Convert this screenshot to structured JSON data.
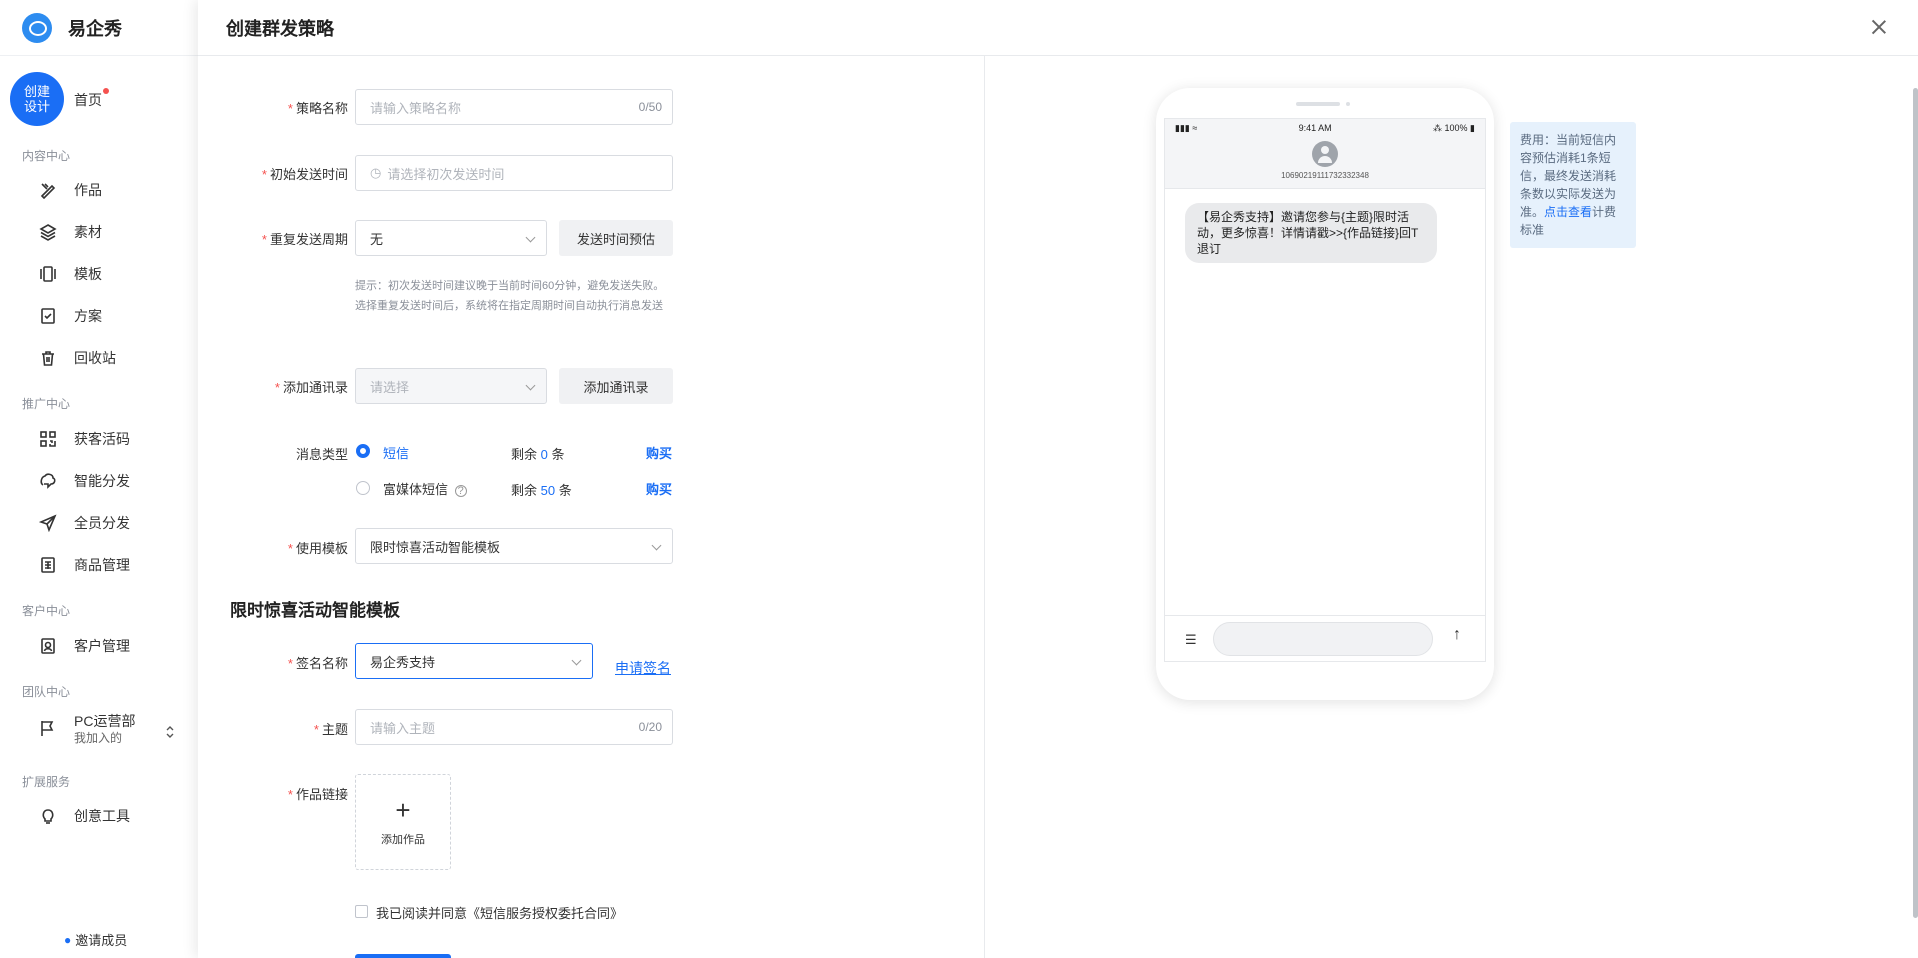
{
  "brand": {
    "name": "易企秀"
  },
  "sidebar": {
    "create_button": "创建设计",
    "home": "首页",
    "sections": [
      {
        "title": "内容中心",
        "items": [
          "作品",
          "素材",
          "模板",
          "方案",
          "回收站"
        ]
      },
      {
        "title": "推广中心",
        "items": [
          "获客活码",
          "智能分发",
          "全员分发",
          "商品管理"
        ]
      },
      {
        "title": "客户中心",
        "items": [
          "客户管理"
        ]
      },
      {
        "title": "团队中心"
      },
      {
        "title": "扩展服务",
        "items": [
          "创意工具"
        ]
      }
    ],
    "team": {
      "name": "PC运营部",
      "sub": "我加入的"
    },
    "invite": "邀请成员"
  },
  "drawer": {
    "title": "创建群发策略",
    "form": {
      "strategy_name": {
        "label": "策略名称",
        "placeholder": "请输入策略名称",
        "counter": "0/50"
      },
      "first_send_time": {
        "label": "初始发送时间",
        "placeholder": "请选择初次发送时间"
      },
      "repeat_cycle": {
        "label": "重复发送周期",
        "value": "无",
        "estimate_button": "发送时间预估"
      },
      "hint": "提示：初次发送时间建议晚于当前时间60分钟，避免发送失败。选择重复发送时间后，系统将在指定周期时间自动执行消息发送",
      "contacts": {
        "label": "添加通讯录",
        "placeholder": "请选择",
        "button": "添加通讯录"
      },
      "message_type": {
        "label": "消息类型",
        "options": [
          {
            "name": "短信",
            "selected": true,
            "remaining_prefix": "剩余",
            "remaining": "0",
            "unit": "条",
            "buy": "购买"
          },
          {
            "name": "富媒体短信",
            "selected": false,
            "remaining_prefix": "剩余",
            "remaining": "50",
            "unit": "条",
            "buy": "购买"
          }
        ]
      },
      "template": {
        "label": "使用模板",
        "value": "限时惊喜活动智能模板"
      },
      "section_title": "限时惊喜活动智能模板",
      "signature": {
        "label": "签名名称",
        "value": "易企秀支持",
        "apply_link": "申请签名"
      },
      "subject": {
        "label": "主题",
        "placeholder": "请输入主题",
        "counter": "0/20"
      },
      "work_link": {
        "label": "作品链接",
        "upload_label": "添加作品"
      },
      "agreement": "我已阅读并同意《短信服务授权委托合同》"
    }
  },
  "preview": {
    "status_time": "9:41 AM",
    "status_battery": "100%",
    "sender_number": "10690219111732332348",
    "message": "【易企秀支持】邀请您参与{主题}限时活动，更多惊喜！详情请戳>>{作品链接}回T退订"
  },
  "fee_note": {
    "text": "费用：当前短信内容预估消耗1条短信，最终发送消耗条数以实际发送为准。",
    "link": "点击查看",
    "suffix": "计费标准"
  },
  "colors": {
    "accent": "#1a6ef5",
    "required": "#f5524f",
    "fee_bg": "#e6f1fc"
  }
}
